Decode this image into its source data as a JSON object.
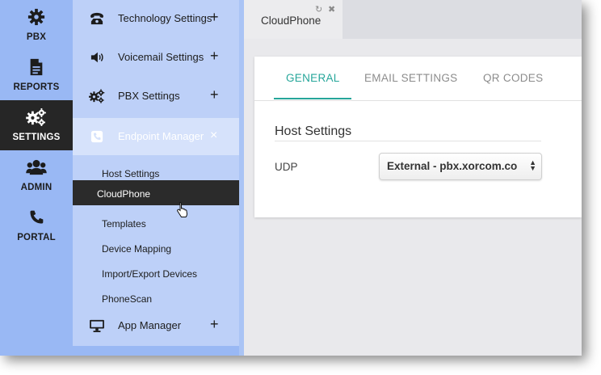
{
  "rail": {
    "items": [
      {
        "label": "PBX",
        "icon": "gear-icon"
      },
      {
        "label": "REPORTS",
        "icon": "document-icon"
      },
      {
        "label": "SETTINGS",
        "icon": "gears-icon"
      },
      {
        "label": "ADMIN",
        "icon": "users-icon"
      },
      {
        "label": "PORTAL",
        "icon": "phone-icon"
      }
    ],
    "active": "SETTINGS"
  },
  "menu": {
    "sections": [
      {
        "label": "Technology Settings",
        "toggle": "+",
        "icon": "telephone-icon"
      },
      {
        "label": "Voicemail Settings",
        "toggle": "+",
        "icon": "speaker-icon"
      },
      {
        "label": "PBX Settings",
        "toggle": "+",
        "icon": "cogs-icon"
      },
      {
        "label": "Endpoint Manager",
        "toggle": "×",
        "icon": "phone-square-icon"
      },
      {
        "label": "App Manager",
        "toggle": "+",
        "icon": "monitor-icon"
      }
    ],
    "endpoint_items": [
      "Host Settings",
      "CloudPhone",
      "Templates",
      "Device Mapping",
      "Import/Export Devices",
      "PhoneScan"
    ],
    "active_item": "CloudPhone"
  },
  "tabstrip": {
    "tab_title": "CloudPhone",
    "refresh_glyph": "↻",
    "close_glyph": "✖"
  },
  "content": {
    "tabs": [
      "GENERAL",
      "EMAIL SETTINGS",
      "QR CODES"
    ],
    "active_tab": "GENERAL",
    "section_title": "Host Settings",
    "udp_label": "UDP",
    "udp_value": "External - pbx.xorcom.co"
  },
  "colors": {
    "rail_bg": "#99b8f4",
    "menu_bg": "#bdd0f8",
    "active_dark": "#262626",
    "accent": "#26a69a"
  }
}
